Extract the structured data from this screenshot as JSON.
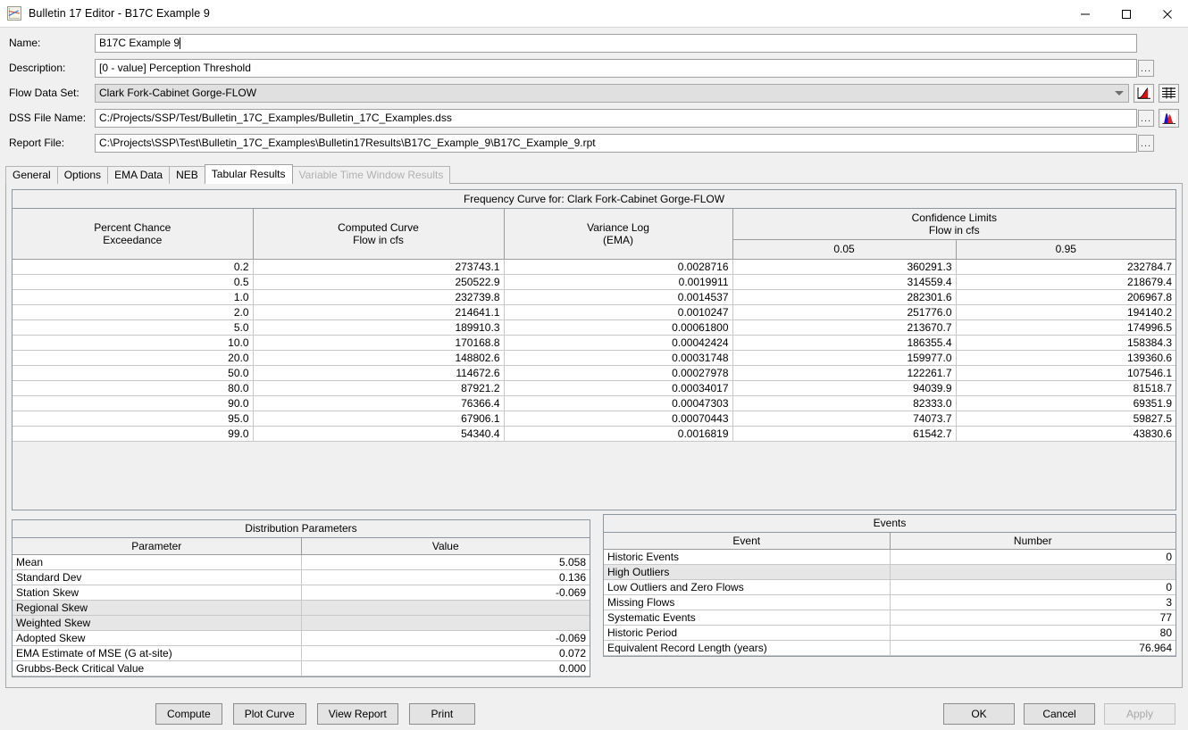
{
  "window": {
    "title": "Bulletin 17 Editor - B17C Example 9",
    "icon": "chart-icon",
    "minimize": "minimize-icon",
    "maximize": "maximize-icon",
    "close": "close-icon"
  },
  "form": {
    "fields": [
      {
        "label": "Name:",
        "value": "B17C Example 9"
      },
      {
        "label": "Description:",
        "value": "[0 - value] Perception Threshold"
      },
      {
        "label": "Flow Data Set:",
        "value": "Clark Fork-Cabinet Gorge-FLOW"
      },
      {
        "label": "DSS File Name:",
        "value": "C:/Projects/SSP/Test/Bulletin_17C_Examples/Bulletin_17C_Examples.dss"
      },
      {
        "label": "Report File:",
        "value": "C:\\Projects\\SSP\\Test\\Bulletin_17C_Examples\\Bulletin17Results\\B17C_Example_9\\B17C_Example_9.rpt"
      }
    ],
    "browse_label": "...",
    "icon_buttons": [
      {
        "name": "frequency-curve-icon",
        "tooltip": "Frequency Curve"
      },
      {
        "name": "tabular-results-icon",
        "tooltip": "Tabular Results"
      },
      {
        "name": "histogram-icon",
        "tooltip": "Histogram"
      }
    ]
  },
  "tabs": [
    {
      "label": "General",
      "active": false,
      "disabled": false
    },
    {
      "label": "Options",
      "active": false,
      "disabled": false
    },
    {
      "label": "EMA Data",
      "active": false,
      "disabled": false
    },
    {
      "label": "NEB",
      "active": false,
      "disabled": false
    },
    {
      "label": "Tabular Results",
      "active": true,
      "disabled": false
    },
    {
      "label": "Variable Time Window Results",
      "active": false,
      "disabled": true
    }
  ],
  "frequency_curve": {
    "title": "Frequency Curve for: Clark Fork-Cabinet Gorge-FLOW",
    "headers": {
      "percent_chance": "Percent Chance\nExceedance",
      "percent_chance_l1": "Percent Chance",
      "percent_chance_l2": "Exceedance",
      "computed_curve_l1": "Computed Curve",
      "computed_curve_l2": "Flow in cfs",
      "variance_log_l1": "Variance Log",
      "variance_log_l2": "(EMA)",
      "confidence_l1": "Confidence Limits",
      "confidence_l2": "Flow in cfs",
      "conf_low": "0.05",
      "conf_high": "0.95"
    },
    "rows": [
      {
        "pct": "0.2",
        "computed": "273743.1",
        "variance": "0.0028716",
        "cl05": "360291.3",
        "cl95": "232784.7"
      },
      {
        "pct": "0.5",
        "computed": "250522.9",
        "variance": "0.0019911",
        "cl05": "314559.4",
        "cl95": "218679.4"
      },
      {
        "pct": "1.0",
        "computed": "232739.8",
        "variance": "0.0014537",
        "cl05": "282301.6",
        "cl95": "206967.8"
      },
      {
        "pct": "2.0",
        "computed": "214641.1",
        "variance": "0.0010247",
        "cl05": "251776.0",
        "cl95": "194140.2"
      },
      {
        "pct": "5.0",
        "computed": "189910.3",
        "variance": "0.00061800",
        "cl05": "213670.7",
        "cl95": "174996.5"
      },
      {
        "pct": "10.0",
        "computed": "170168.8",
        "variance": "0.00042424",
        "cl05": "186355.4",
        "cl95": "158384.3"
      },
      {
        "pct": "20.0",
        "computed": "148802.6",
        "variance": "0.00031748",
        "cl05": "159977.0",
        "cl95": "139360.6"
      },
      {
        "pct": "50.0",
        "computed": "114672.6",
        "variance": "0.00027978",
        "cl05": "122261.7",
        "cl95": "107546.1"
      },
      {
        "pct": "80.0",
        "computed": "87921.2",
        "variance": "0.00034017",
        "cl05": "94039.9",
        "cl95": "81518.7"
      },
      {
        "pct": "90.0",
        "computed": "76366.4",
        "variance": "0.00047303",
        "cl05": "82333.0",
        "cl95": "69351.9"
      },
      {
        "pct": "95.0",
        "computed": "67906.1",
        "variance": "0.00070443",
        "cl05": "74073.7",
        "cl95": "59827.5"
      },
      {
        "pct": "99.0",
        "computed": "54340.4",
        "variance": "0.0016819",
        "cl05": "61542.7",
        "cl95": "43830.6"
      }
    ]
  },
  "distribution_parameters": {
    "title": "Distribution Parameters",
    "col_parameter": "Parameter",
    "col_value": "Value",
    "rows": [
      {
        "name": "Mean",
        "value": "5.058",
        "disabled": false
      },
      {
        "name": "Standard Dev",
        "value": "0.136",
        "disabled": false
      },
      {
        "name": "Station Skew",
        "value": "-0.069",
        "disabled": false
      },
      {
        "name": "Regional Skew",
        "value": "",
        "disabled": true
      },
      {
        "name": "Weighted Skew",
        "value": "",
        "disabled": true
      },
      {
        "name": "Adopted Skew",
        "value": "-0.069",
        "disabled": false
      },
      {
        "name": "EMA Estimate of MSE (G at-site)",
        "value": "0.072",
        "disabled": false
      },
      {
        "name": "Grubbs-Beck Critical Value",
        "value": "0.000",
        "disabled": false
      }
    ]
  },
  "events": {
    "title": "Events",
    "col_event": "Event",
    "col_number": "Number",
    "rows": [
      {
        "name": "Historic Events",
        "value": "0",
        "disabled": false
      },
      {
        "name": "High Outliers",
        "value": "",
        "disabled": true
      },
      {
        "name": "Low Outliers and Zero Flows",
        "value": "0",
        "disabled": false
      },
      {
        "name": "Missing Flows",
        "value": "3",
        "disabled": false
      },
      {
        "name": "Systematic Events",
        "value": "77",
        "disabled": false
      },
      {
        "name": "Historic Period",
        "value": "80",
        "disabled": false
      },
      {
        "name": "Equivalent Record Length (years)",
        "value": "76.964",
        "disabled": false
      }
    ]
  },
  "buttons": {
    "left": [
      {
        "label": "Compute",
        "disabled": false
      },
      {
        "label": "Plot Curve",
        "disabled": false
      },
      {
        "label": "View Report",
        "disabled": false
      },
      {
        "label": "Print",
        "disabled": false
      }
    ],
    "right": [
      {
        "label": "OK",
        "disabled": false
      },
      {
        "label": "Cancel",
        "disabled": false
      },
      {
        "label": "Apply",
        "disabled": true
      }
    ]
  },
  "colors": {
    "window_bg": "#f0f0f0",
    "titlebar": "#ffffff",
    "field_bg": "#ffffff",
    "readonly_bg": "#e0e0e0",
    "border": "#a0a0a0",
    "accent_red": "#e02020",
    "accent_blue": "#1414c8"
  }
}
